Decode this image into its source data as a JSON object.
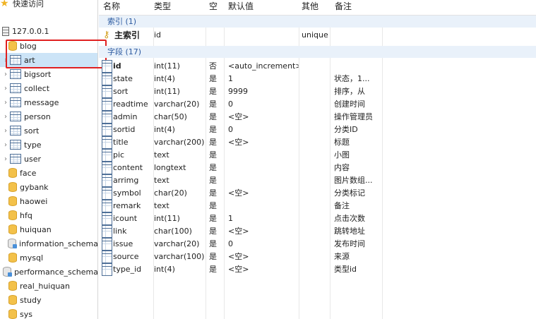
{
  "tree": {
    "quick_access": "快速访问",
    "connection": "127.0.0.1",
    "items": [
      {
        "label": "blog",
        "kind": "db-open"
      },
      {
        "label": "art",
        "kind": "table",
        "selected": true
      },
      {
        "label": "bigsort",
        "kind": "table"
      },
      {
        "label": "collect",
        "kind": "table"
      },
      {
        "label": "message",
        "kind": "table"
      },
      {
        "label": "person",
        "kind": "table"
      },
      {
        "label": "sort",
        "kind": "table"
      },
      {
        "label": "type",
        "kind": "table"
      },
      {
        "label": "user",
        "kind": "table"
      },
      {
        "label": "face",
        "kind": "db"
      },
      {
        "label": "gybank",
        "kind": "db"
      },
      {
        "label": "haowei",
        "kind": "db"
      },
      {
        "label": "hfq",
        "kind": "db"
      },
      {
        "label": "huiquan",
        "kind": "db"
      },
      {
        "label": "information_schema",
        "kind": "db-sys"
      },
      {
        "label": "mysql",
        "kind": "db"
      },
      {
        "label": "performance_schema",
        "kind": "db-sys"
      },
      {
        "label": "real_huiquan",
        "kind": "db"
      },
      {
        "label": "study",
        "kind": "db"
      },
      {
        "label": "sys",
        "kind": "db"
      }
    ]
  },
  "grid": {
    "headers": {
      "name": "名称",
      "type": "类型",
      "null": "空",
      "default": "默认值",
      "other": "其他",
      "note": "备注"
    },
    "index_section": "索引 (1)",
    "index_row": {
      "name": "主索引",
      "type": "id",
      "other": "unique"
    },
    "field_section": "字段 (17)",
    "fields": [
      {
        "name": "id",
        "type": "int(11)",
        "null": "否",
        "default": "<auto_increment>",
        "note": "",
        "key": true
      },
      {
        "name": "state",
        "type": "int(4)",
        "null": "是",
        "default": "1",
        "note": "状态，1..."
      },
      {
        "name": "sort",
        "type": "int(11)",
        "null": "是",
        "default": "9999",
        "note": "排序，从"
      },
      {
        "name": "readtime",
        "type": "varchar(20)",
        "null": "是",
        "default": "0",
        "note": "创建时间"
      },
      {
        "name": "admin",
        "type": "char(50)",
        "null": "是",
        "default": "<空>",
        "note": "操作管理员"
      },
      {
        "name": "sortid",
        "type": "int(4)",
        "null": "是",
        "default": "0",
        "note": "分类ID"
      },
      {
        "name": "title",
        "type": "varchar(200)",
        "null": "是",
        "default": "<空>",
        "note": "标题"
      },
      {
        "name": "pic",
        "type": "text",
        "null": "是",
        "default": "",
        "note": "小图"
      },
      {
        "name": "content",
        "type": "longtext",
        "null": "是",
        "default": "",
        "note": "内容"
      },
      {
        "name": "arrimg",
        "type": "text",
        "null": "是",
        "default": "",
        "note": "图片数组..."
      },
      {
        "name": "symbol",
        "type": "char(20)",
        "null": "是",
        "default": "<空>",
        "note": "分类标记"
      },
      {
        "name": "remark",
        "type": "text",
        "null": "是",
        "default": "",
        "note": "备注"
      },
      {
        "name": "icount",
        "type": "int(11)",
        "null": "是",
        "default": "1",
        "note": "点击次数"
      },
      {
        "name": "link",
        "type": "char(100)",
        "null": "是",
        "default": "<空>",
        "note": "跳转地址"
      },
      {
        "name": "issue",
        "type": "varchar(20)",
        "null": "是",
        "default": "0",
        "note": "发布时间"
      },
      {
        "name": "source",
        "type": "varchar(100)",
        "null": "是",
        "default": "<空>",
        "note": "来源"
      },
      {
        "name": "type_id",
        "type": "int(4)",
        "null": "是",
        "default": "<空>",
        "note": "类型id"
      }
    ]
  },
  "colors": {
    "highlight": "#e02020",
    "selected": "#cce4f7",
    "section_bg": "#e9f1fa",
    "section_text": "#2c5aa0",
    "db_icon": "#f3c14a"
  }
}
